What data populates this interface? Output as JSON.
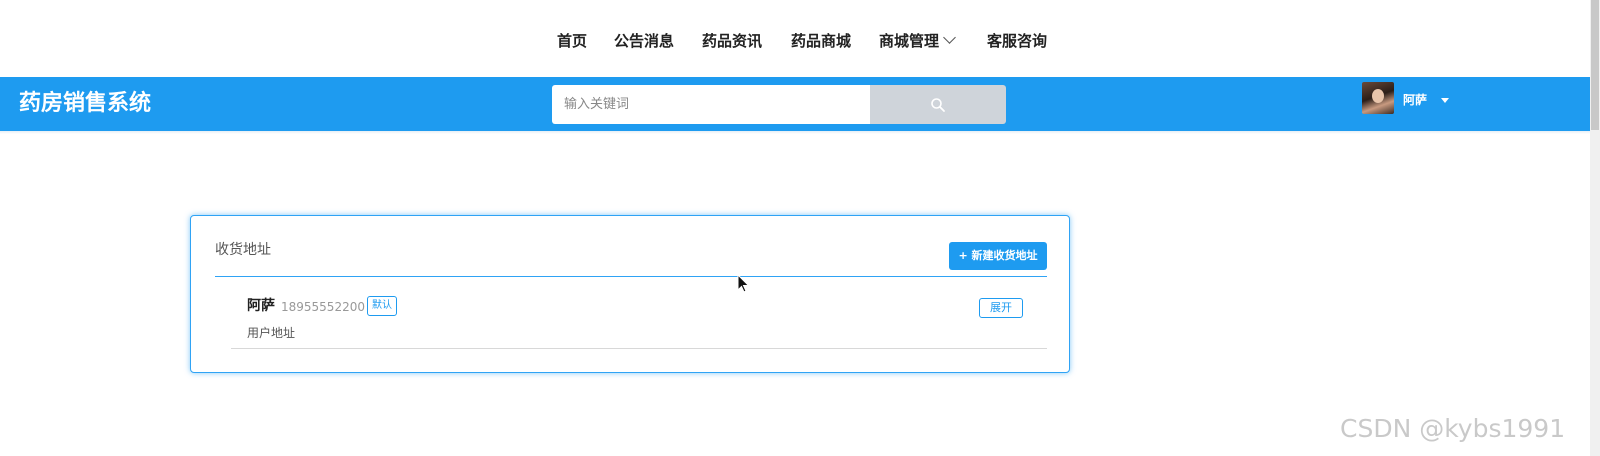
{
  "nav": {
    "items": [
      {
        "label": "首页"
      },
      {
        "label": "公告消息"
      },
      {
        "label": "药品资讯"
      },
      {
        "label": "药品商城"
      },
      {
        "label": "商城管理"
      },
      {
        "label": "客服咨询"
      }
    ]
  },
  "header": {
    "brand": "药房销售系统",
    "search_placeholder": "输入关键词",
    "search_icon": "search-icon",
    "username": "阿萨"
  },
  "address_card": {
    "title": "收货地址",
    "new_button": "+ 新建收货地址",
    "entries": [
      {
        "name": "阿萨",
        "phone": "18955552200",
        "badge": "默认",
        "address": "用户地址",
        "action": "展开"
      }
    ]
  },
  "watermark": "CSDN @kybs1991",
  "colors": {
    "brand_blue": "#1e9bf0",
    "search_button": "#cfd4da"
  }
}
